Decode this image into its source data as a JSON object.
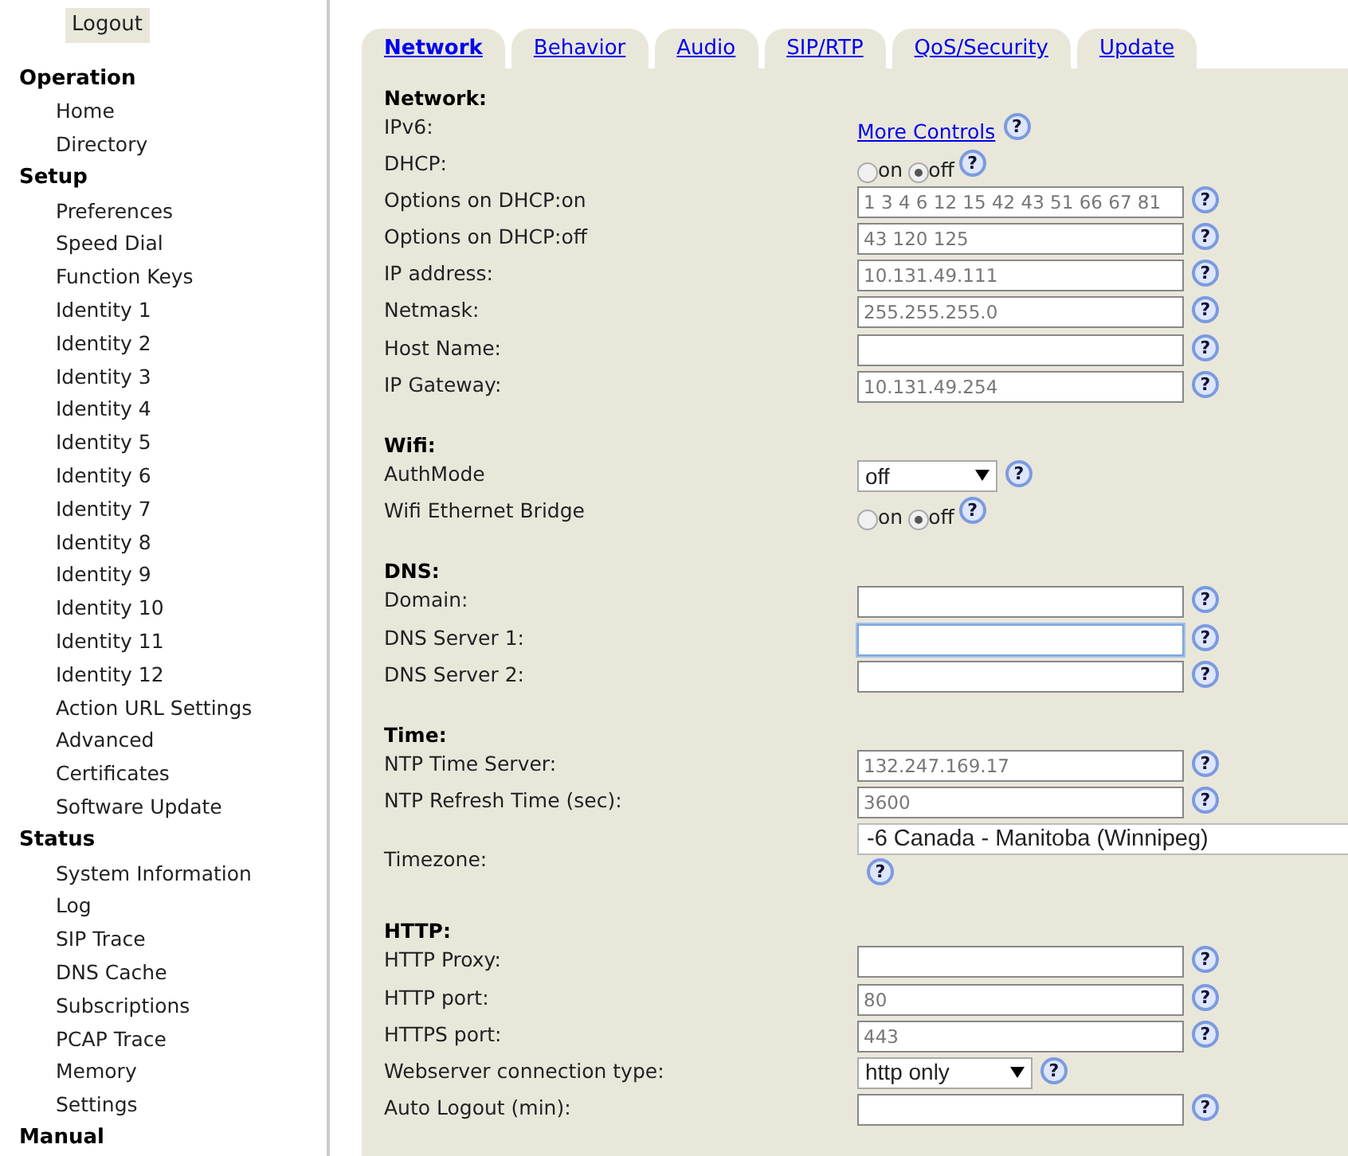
{
  "sidebar": {
    "logout": "Logout",
    "groups": [
      {
        "title": "Operation",
        "items": [
          "Home",
          "Directory"
        ]
      },
      {
        "title": "Setup",
        "items": [
          "Preferences",
          "Speed Dial",
          "Function Keys",
          "Identity 1",
          "Identity 2",
          "Identity 3",
          "Identity 4",
          "Identity 5",
          "Identity 6",
          "Identity 7",
          "Identity 8",
          "Identity 9",
          "Identity 10",
          "Identity 11",
          "Identity 12",
          "Action URL Settings",
          "Advanced",
          "Certificates",
          "Software Update"
        ]
      },
      {
        "title": "Status",
        "items": [
          "System Information",
          "Log",
          "SIP Trace",
          "DNS Cache",
          "Subscriptions",
          "PCAP Trace",
          "Memory",
          "Settings"
        ]
      },
      {
        "title": "Manual"
      }
    ]
  },
  "tabs": [
    {
      "label": "Network",
      "selected": true
    },
    {
      "label": "Behavior",
      "selected": false
    },
    {
      "label": "Audio",
      "selected": false
    },
    {
      "label": "SIP/RTP",
      "selected": false
    },
    {
      "label": "QoS/Security",
      "selected": false
    },
    {
      "label": "Update",
      "selected": false
    }
  ],
  "sections": [
    {
      "title": "Network:",
      "rows": [
        {
          "label": "IPv6:",
          "kind": "link",
          "text": "More Controls",
          "help": "?"
        },
        {
          "label": "DHCP:",
          "kind": "radio",
          "options": [
            {
              "text": "on",
              "selected": false
            },
            {
              "text": "off",
              "selected": true
            }
          ],
          "help": "?"
        },
        {
          "label": "Options on DHCP:on",
          "kind": "text",
          "placeholder": "1 3 4 6 12 15 42 43 51 66 67 81",
          "focused": false,
          "help": "?"
        },
        {
          "label": "Options on DHCP:off",
          "kind": "text",
          "placeholder": "43 120 125",
          "focused": false,
          "help": "?"
        },
        {
          "label": "IP address:",
          "kind": "text",
          "placeholder": "10.131.49.111",
          "focused": false,
          "help": "?"
        },
        {
          "label": "Netmask:",
          "kind": "text",
          "placeholder": "255.255.255.0",
          "focused": false,
          "help": "?"
        },
        {
          "label": "Host Name:",
          "kind": "text",
          "focused": false,
          "help": "?"
        },
        {
          "label": "IP Gateway:",
          "kind": "text",
          "placeholder": "10.131.49.254",
          "focused": false,
          "help": "?"
        }
      ]
    },
    {
      "title": "Wifi:",
      "rows": [
        {
          "label": "AuthMode",
          "kind": "select",
          "value": "off",
          "help": "?"
        },
        {
          "label": "Wifi Ethernet Bridge",
          "kind": "radio",
          "options": [
            {
              "text": "on",
              "selected": false
            },
            {
              "text": "off",
              "selected": true
            }
          ],
          "help": "?"
        }
      ]
    },
    {
      "title": "DNS:",
      "rows": [
        {
          "label": "Domain:",
          "kind": "text",
          "focused": false,
          "help": "?"
        },
        {
          "label": "DNS Server 1:",
          "kind": "text",
          "focused": true,
          "help": "?"
        },
        {
          "label": "DNS Server 2:",
          "kind": "text",
          "focused": false,
          "help": "?"
        }
      ]
    },
    {
      "title": "Time:",
      "rows": [
        {
          "label": "NTP Time Server:",
          "kind": "text",
          "placeholder": "132.247.169.17",
          "focused": false,
          "help": "?"
        },
        {
          "label": "NTP Refresh Time (sec):",
          "kind": "text",
          "placeholder": "3600",
          "focused": false,
          "help": "?"
        },
        {
          "label": "Timezone:",
          "kind": "wideselect",
          "value": "-6 Canada - Manitoba (Winnipeg)",
          "help": "?"
        }
      ]
    },
    {
      "title": "HTTP:",
      "rows": [
        {
          "label": "HTTP Proxy:",
          "kind": "text",
          "focused": false,
          "help": "?"
        },
        {
          "label": "HTTP port:",
          "kind": "text",
          "placeholder": "80",
          "focused": false,
          "help": "?"
        },
        {
          "label": "HTTPS port:",
          "kind": "text",
          "placeholder": "443",
          "focused": false,
          "help": "?"
        },
        {
          "label": "Webserver connection type:",
          "kind": "select",
          "value": "http only",
          "help": "?"
        },
        {
          "label": "Auto Logout (min):",
          "kind": "text",
          "focused": false,
          "help": "?"
        }
      ]
    }
  ]
}
